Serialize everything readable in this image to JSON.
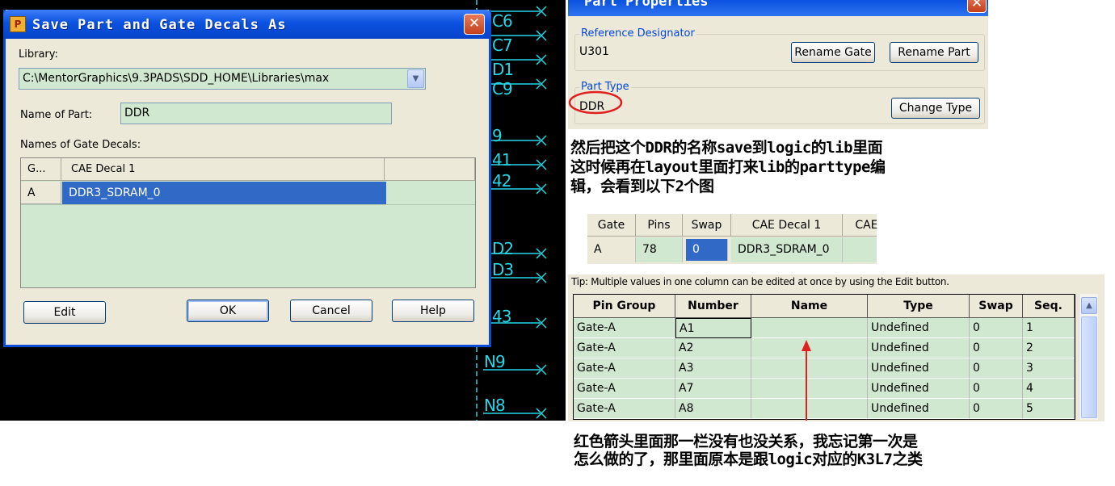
{
  "schematic": {
    "top_labels": [
      "C6",
      "C7",
      "D1",
      "C9"
    ],
    "mid_labels": [
      "9",
      "41",
      "42"
    ],
    "lower_labels": [
      "D2",
      "D3",
      "43"
    ],
    "bottom_labels": [
      "N9",
      "N8"
    ],
    "color": "#27d6e6"
  },
  "save_dialog": {
    "title": "Save Part and Gate Decals As",
    "icon_glyph": "P",
    "close_glyph": "✕",
    "library_label": "Library:",
    "library_value": "C:\\MentorGraphics\\9.3PADS\\SDD_HOME\\Libraries\\max",
    "name_label": "Name of Part:",
    "name_value": "DDR",
    "gate_decals_label": "Names of Gate Decals:",
    "grid": {
      "headers": [
        "G...",
        "CAE Decal 1"
      ],
      "rows": [
        [
          "A",
          "DDR3_SDRAM_0"
        ]
      ]
    },
    "buttons": {
      "edit": "Edit",
      "ok": "OK",
      "cancel": "Cancel",
      "help": "Help"
    }
  },
  "part_properties": {
    "title": "Part Properties",
    "ref_designator_label": "Reference Designator",
    "ref_designator_value": "U301",
    "rename_gate": "Rename Gate",
    "rename_part": "Rename Part",
    "part_type_label": "Part Type",
    "part_type_value": "DDR",
    "change_type": "Change Type",
    "highlight_color": "#e02020"
  },
  "note_1": [
    "然后把这个DDR的名称save到logic的lib里面",
    "这时候再在layout里面打来lib的parttype编",
    "辑，会看到以下2个图"
  ],
  "gates_table": {
    "headers": [
      "Gate",
      "Pins",
      "Swap",
      "CAE Decal 1",
      "CAE"
    ],
    "row": [
      "A",
      "78",
      "0",
      "DDR3_SDRAM_0",
      ""
    ]
  },
  "pins": {
    "tip": "Tip: Multiple values in one column can be edited at once by using the Edit button.",
    "headers": [
      "Pin Group",
      "Number",
      "Name",
      "Type",
      "Swap",
      "Seq."
    ],
    "rows": [
      [
        "Gate-A",
        "A1",
        "",
        "Undefined",
        "0",
        "1"
      ],
      [
        "Gate-A",
        "A2",
        "",
        "Undefined",
        "0",
        "2"
      ],
      [
        "Gate-A",
        "A3",
        "",
        "Undefined",
        "0",
        "3"
      ],
      [
        "Gate-A",
        "A7",
        "",
        "Undefined",
        "0",
        "4"
      ],
      [
        "Gate-A",
        "A8",
        "",
        "Undefined",
        "0",
        "5"
      ]
    ],
    "scroll_up_glyph": "▲",
    "arrow_color": "#e02020"
  },
  "note_2": [
    "红色箭头里面那一栏没有也没关系，我忘记第一次是",
    "怎么做的了，那里面原本是跟logic对应的K3L7之类"
  ]
}
